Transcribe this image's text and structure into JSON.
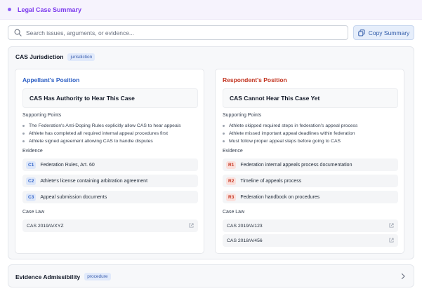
{
  "header": {
    "title": "Legal Case Summary"
  },
  "search": {
    "placeholder": "Search issues, arguments, or evidence..."
  },
  "toolbar": {
    "copy_label": "Copy Summary"
  },
  "sections": [
    {
      "title": "CAS Jurisdiction",
      "tag": "jurisdiction",
      "appellant": {
        "heading": "Appellant's Position",
        "claim": "CAS Has Authority to Hear This Case",
        "points_label": "Supporting Points",
        "points": [
          "The Federation's Anti-Doping Rules explicitly allow CAS to hear appeals",
          "Athlete has completed all required internal appeal procedures first",
          "Athlete signed agreement allowing CAS to handle disputes"
        ],
        "evidence_label": "Evidence",
        "evidence": [
          {
            "id": "C1",
            "text": "Federation Rules, Art. 60"
          },
          {
            "id": "C2",
            "text": "Athlete's license containing arbitration agreement"
          },
          {
            "id": "C3",
            "text": "Appeal submission documents"
          }
        ],
        "caselaw_label": "Case Law",
        "caselaw": [
          "CAS 2019/A/XYZ"
        ]
      },
      "respondent": {
        "heading": "Respondent's Position",
        "claim": "CAS Cannot Hear This Case Yet",
        "points_label": "Supporting Points",
        "points": [
          "Athlete skipped required steps in federation's appeal process",
          "Athlete missed important appeal deadlines within federation",
          "Must follow proper appeal steps before going to CAS"
        ],
        "evidence_label": "Evidence",
        "evidence": [
          {
            "id": "R1",
            "text": "Federation internal appeals process documentation"
          },
          {
            "id": "R2",
            "text": "Timeline of appeals process"
          },
          {
            "id": "R3",
            "text": "Federation handbook on procedures"
          }
        ],
        "caselaw_label": "Case Law",
        "caselaw": [
          "CAS 2019/A/123",
          "CAS 2018/A/456"
        ]
      }
    },
    {
      "title": "Evidence Admissibility",
      "tag": "procedure"
    }
  ],
  "colors": {
    "accent": "#7c3aed",
    "appellant": "#2d5fc4",
    "respondent": "#c2331f",
    "tag_bg": "#e1eafb"
  }
}
